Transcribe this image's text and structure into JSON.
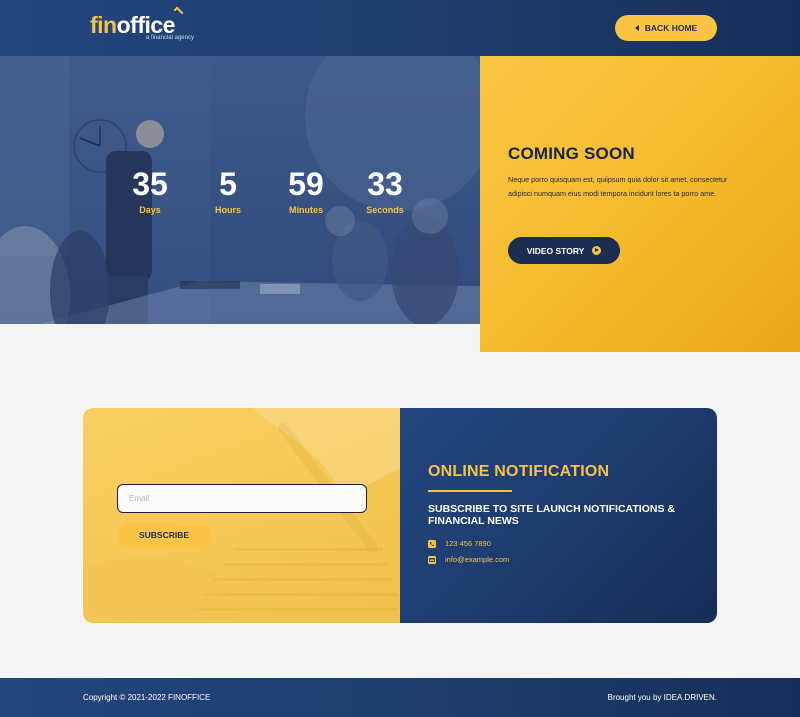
{
  "brand": {
    "name_part1": "fin",
    "name_part2": "office",
    "tagline": "a financial agency"
  },
  "header": {
    "back_home_label": "BACK HOME"
  },
  "countdown": [
    {
      "value": "35",
      "label": "Days"
    },
    {
      "value": "5",
      "label": "Hours"
    },
    {
      "value": "59",
      "label": "Minutes"
    },
    {
      "value": "33",
      "label": "Seconds"
    }
  ],
  "coming_soon": {
    "title": "COMING SOON",
    "text": "Neque porro quisquam est, quiipsum quia dolor sit amet, consectetur adipisci numquam eius modi tempora incidunt lores ta porro ame.",
    "video_label": "VIDEO STORY"
  },
  "subscribe": {
    "email_placeholder": "Email",
    "email_value": "",
    "button_label": "SUBSCRIBE"
  },
  "notification": {
    "title": "ONLINE NOTIFICATION",
    "subtitle": "SUBSCRIBE TO SITE LAUNCH NOTIFICATIONS & FINANCIAL NEWS",
    "phone": "123 456 7890",
    "email": "info@example.com"
  },
  "footer": {
    "copyright": "Copyright © 2021-2022 FINOFFICE",
    "brought_by": "Brought you by IDEA.DRIVEN."
  },
  "colors": {
    "navy": "#1d3a6a",
    "yellow": "#f6c24a",
    "dark_text": "#1a2340"
  },
  "icons": {
    "back": "caret-left-icon",
    "play": "play-circle-icon",
    "phone": "phone-icon",
    "mail": "envelope-icon"
  }
}
